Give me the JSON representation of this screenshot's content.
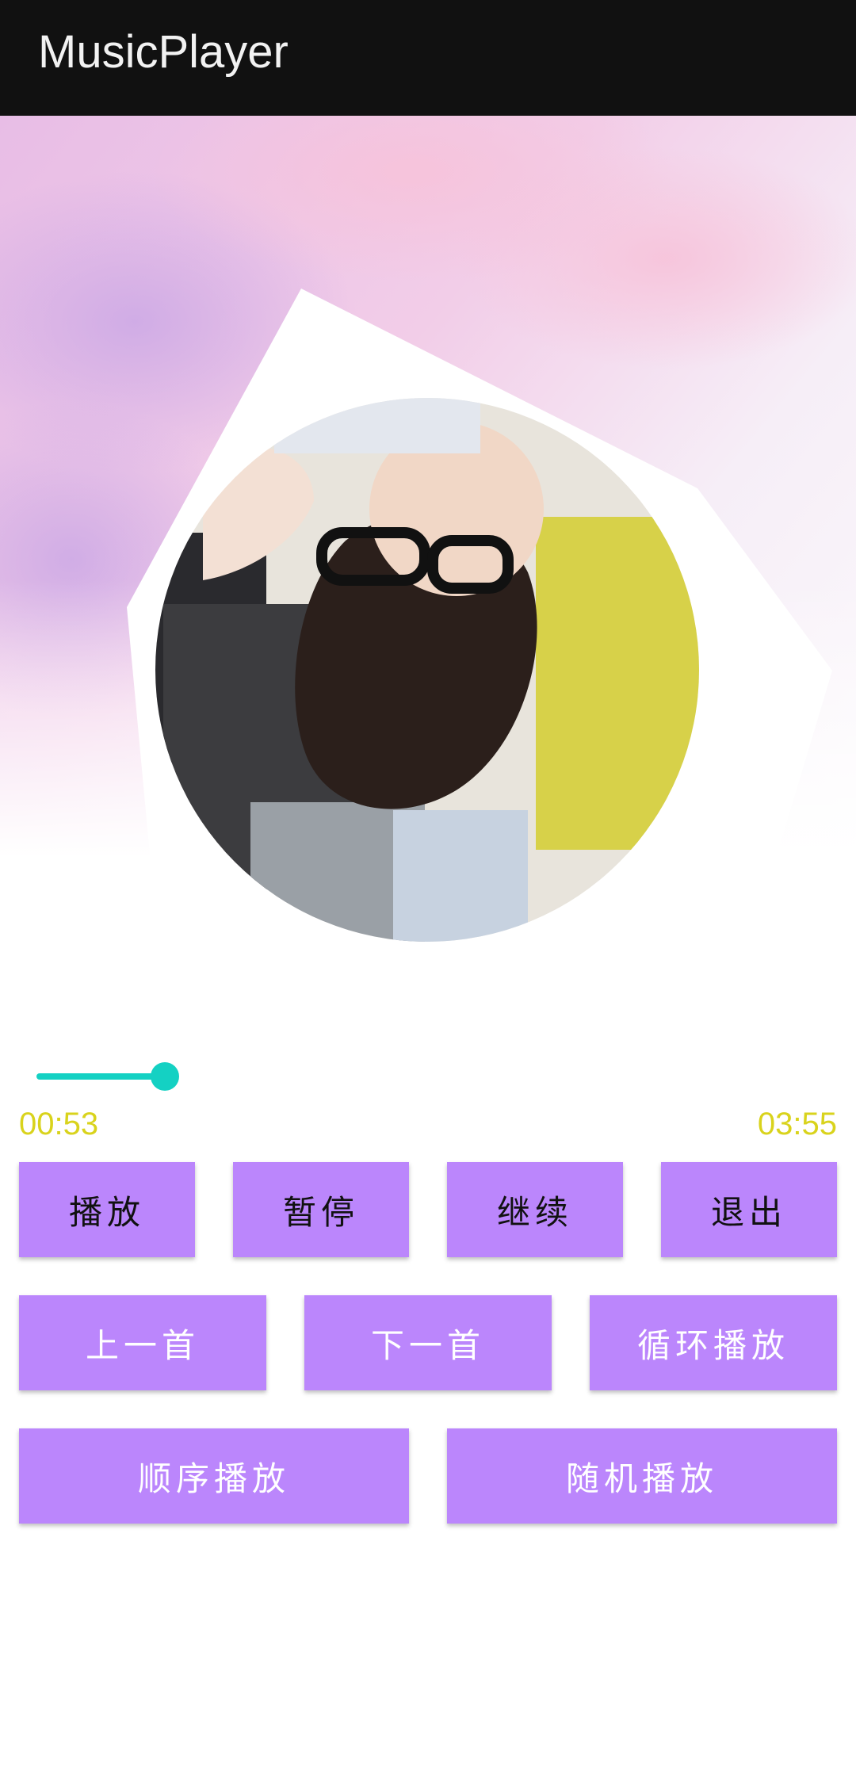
{
  "app_bar": {
    "title": "MusicPlayer"
  },
  "player": {
    "progress_fraction": 0.16,
    "current_time": "00:53",
    "total_time": "03:55"
  },
  "buttons": {
    "play": "播放",
    "pause": "暂停",
    "resume": "继续",
    "exit": "退出",
    "previous": "上一首",
    "next": "下一首",
    "loop": "循环播放",
    "sequential": "顺序播放",
    "shuffle": "随机播放"
  },
  "colors": {
    "app_bar": "#111111",
    "accent_teal": "#14d1c3",
    "time_text": "#d9d31c",
    "button_bg": "#bb86fc"
  },
  "icons": {
    "album_art": "album-cover-image",
    "background": "pastel-sky-background"
  }
}
